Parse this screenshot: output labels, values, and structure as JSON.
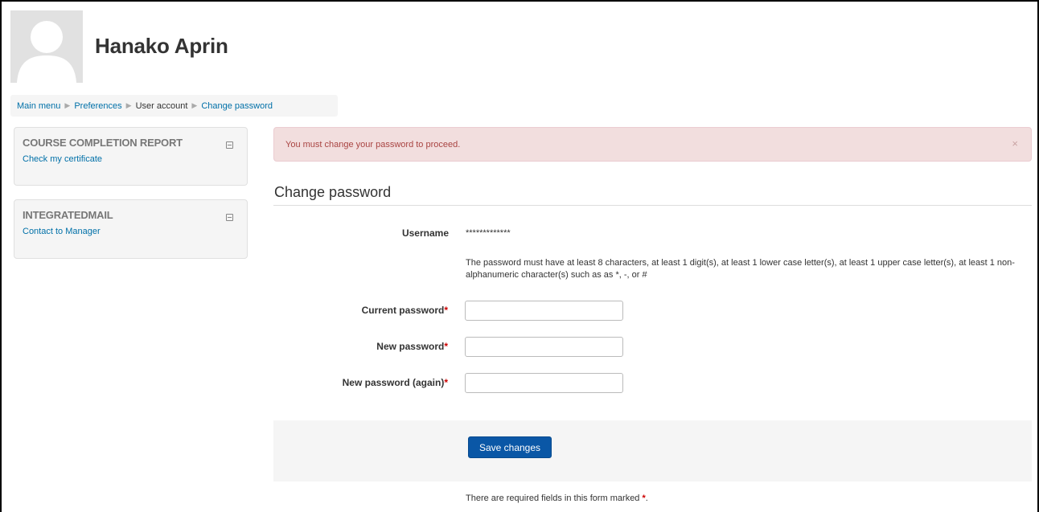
{
  "header": {
    "user_name": "Hanako Aprin",
    "avatar_icon": "user-silhouette-icon"
  },
  "breadcrumb": {
    "items": [
      "Main menu",
      "Preferences",
      "User account",
      "Change password"
    ],
    "separator_icon": "triangle-right-icon"
  },
  "blocks": [
    {
      "title": "COURSE COMPLETION REPORT",
      "link": "Check my certificate"
    },
    {
      "title": "INTEGRATEDMAIL",
      "link": "Contact to Manager"
    }
  ],
  "alert": {
    "message": "You must change your password to proceed.",
    "close": "×"
  },
  "form": {
    "title": "Change password",
    "username_label": "Username",
    "username_value": "*************",
    "help_text": "The password must have at least 8 characters, at least 1 digit(s), at least 1 lower case letter(s), at least 1 upper case letter(s), at least 1 non-alphanumeric character(s) such as as *, -, or #",
    "current_label": "Current password",
    "new_label": "New password",
    "new_again_label": "New password (again)",
    "required_mark": "*",
    "save_label": "Save changes",
    "footnote_text": "There are required fields in this form marked",
    "footnote_end": "."
  },
  "colors": {
    "link": "#0070a8",
    "alert_bg": "#f2dede",
    "alert_text": "#a94442",
    "primary_button": "#0a57a6",
    "required": "#cc0000"
  }
}
